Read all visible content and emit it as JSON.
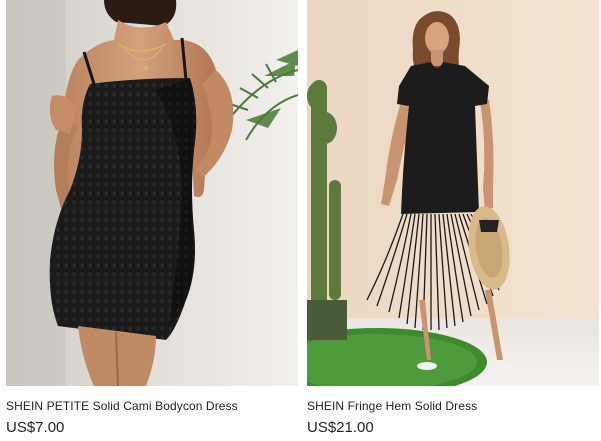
{
  "products": [
    {
      "title": "SHEIN PETITE Solid Cami Bodycon Dress",
      "price": "US$7.00",
      "image": "black-cami-bodycon-dress-photo"
    },
    {
      "title": "SHEIN Fringe Hem Solid Dress",
      "price": "US$21.00",
      "image": "black-fringe-hem-dress-photo"
    }
  ],
  "colors": {
    "text": "#222222",
    "dress": "#1c1c1c",
    "left_bg": "#d9d6d2",
    "right_bg": "#eedbc6"
  }
}
